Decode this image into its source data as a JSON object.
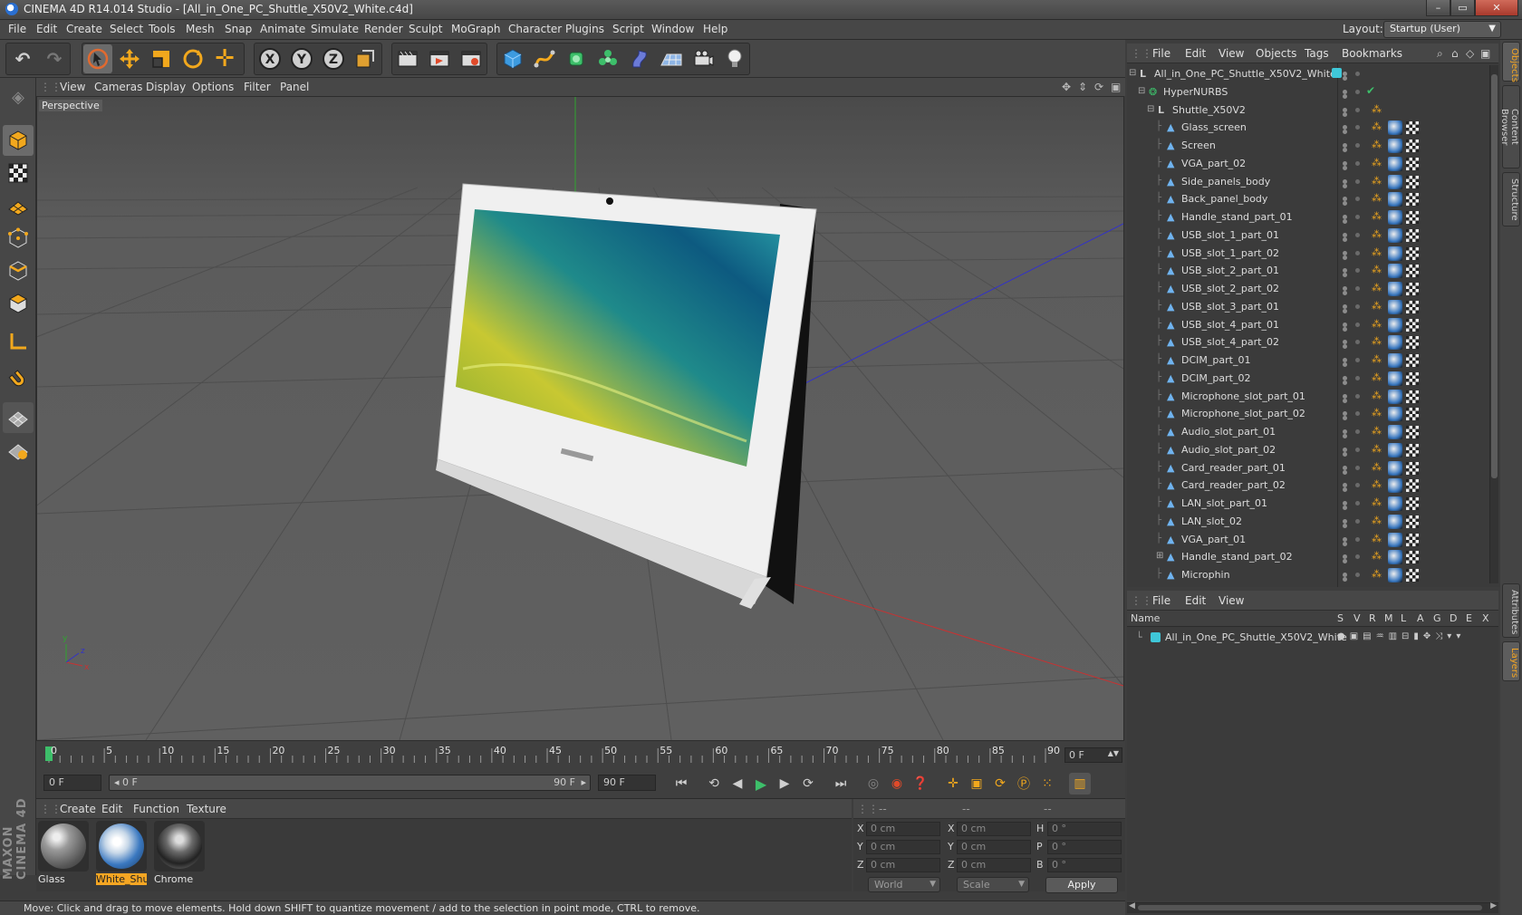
{
  "window": {
    "title": "CINEMA 4D R14.014 Studio - [All_in_One_PC_Shuttle_X50V2_White.c4d]",
    "controls": {
      "minimize": "–",
      "restore": "▭",
      "close": "✕"
    }
  },
  "menubar": {
    "items": [
      "File",
      "Edit",
      "Create",
      "Select",
      "Tools",
      "Mesh",
      "Snap",
      "Animate",
      "Simulate",
      "Render",
      "Sculpt",
      "MoGraph",
      "Character",
      "Plugins",
      "Script",
      "Window",
      "Help"
    ],
    "layout_label": "Layout:",
    "layout_value": "Startup (User)"
  },
  "viewport": {
    "menu": [
      "View",
      "Cameras",
      "Display",
      "Options",
      "Filter",
      "Panel"
    ],
    "label": "Perspective"
  },
  "timeline": {
    "ticks": [
      "0",
      "5",
      "10",
      "15",
      "20",
      "25",
      "30",
      "35",
      "40",
      "45",
      "50",
      "55",
      "60",
      "65",
      "70",
      "75",
      "80",
      "85",
      "90"
    ],
    "current_frame_field": "0 F"
  },
  "transport": {
    "start_field": "0 F",
    "range_start": "0 F",
    "range_end": "90 F",
    "end_field": "90 F"
  },
  "materials": {
    "menu": [
      "Create",
      "Edit",
      "Function",
      "Texture"
    ],
    "items": [
      {
        "name": "Glass",
        "selected": false
      },
      {
        "name": "White_Shu",
        "selected": true
      },
      {
        "name": "Chrome",
        "selected": false
      }
    ]
  },
  "coordinates": {
    "headers": [
      "--",
      "--",
      "--"
    ],
    "rows": [
      {
        "a": "X",
        "av": "0 cm",
        "b": "X",
        "bv": "0 cm",
        "c": "H",
        "cv": "0 °"
      },
      {
        "a": "Y",
        "av": "0 cm",
        "b": "Y",
        "bv": "0 cm",
        "c": "P",
        "cv": "0 °"
      },
      {
        "a": "Z",
        "av": "0 cm",
        "b": "Z",
        "bv": "0 cm",
        "c": "B",
        "cv": "0 °"
      }
    ],
    "mode_select": "World",
    "scale_select": "Scale",
    "apply_label": "Apply"
  },
  "status": "Move: Click and drag to move elements. Hold down SHIFT to quantize movement / add to the selection in point mode, CTRL to remove.",
  "object_manager": {
    "menu": [
      "File",
      "Edit",
      "View",
      "Objects",
      "Tags",
      "Bookmarks"
    ],
    "objects": [
      {
        "name": "All_in_One_PC_Shuttle_X50V2_White",
        "level": 0,
        "type": "null"
      },
      {
        "name": "HyperNURBS",
        "level": 1,
        "type": "nurbs"
      },
      {
        "name": "Shuttle_X50V2",
        "level": 2,
        "type": "null"
      },
      {
        "name": "Glass_screen",
        "level": 3,
        "type": "poly"
      },
      {
        "name": "Screen",
        "level": 3,
        "type": "poly"
      },
      {
        "name": "VGA_part_02",
        "level": 3,
        "type": "poly"
      },
      {
        "name": "Side_panels_body",
        "level": 3,
        "type": "poly"
      },
      {
        "name": "Back_panel_body",
        "level": 3,
        "type": "poly"
      },
      {
        "name": "Handle_stand_part_01",
        "level": 3,
        "type": "poly"
      },
      {
        "name": "USB_slot_1_part_01",
        "level": 3,
        "type": "poly"
      },
      {
        "name": "USB_slot_1_part_02",
        "level": 3,
        "type": "poly"
      },
      {
        "name": "USB_slot_2_part_01",
        "level": 3,
        "type": "poly"
      },
      {
        "name": "USB_slot_2_part_02",
        "level": 3,
        "type": "poly"
      },
      {
        "name": "USB_slot_3_part_01",
        "level": 3,
        "type": "poly"
      },
      {
        "name": "USB_slot_4_part_01",
        "level": 3,
        "type": "poly"
      },
      {
        "name": "USB_slot_4_part_02",
        "level": 3,
        "type": "poly"
      },
      {
        "name": "DCIM_part_01",
        "level": 3,
        "type": "poly"
      },
      {
        "name": "DCIM_part_02",
        "level": 3,
        "type": "poly"
      },
      {
        "name": "Microphone_slot_part_01",
        "level": 3,
        "type": "poly"
      },
      {
        "name": "Microphone_slot_part_02",
        "level": 3,
        "type": "poly"
      },
      {
        "name": "Audio_slot_part_01",
        "level": 3,
        "type": "poly"
      },
      {
        "name": "Audio_slot_part_02",
        "level": 3,
        "type": "poly"
      },
      {
        "name": "Card_reader_part_01",
        "level": 3,
        "type": "poly"
      },
      {
        "name": "Card_reader_part_02",
        "level": 3,
        "type": "poly"
      },
      {
        "name": "LAN_slot_part_01",
        "level": 3,
        "type": "poly"
      },
      {
        "name": "LAN_slot_02",
        "level": 3,
        "type": "poly"
      },
      {
        "name": "VGA_part_01",
        "level": 3,
        "type": "poly"
      },
      {
        "name": "Handle_stand_part_02",
        "level": 3,
        "type": "poly"
      },
      {
        "name": "Microphin",
        "level": 3,
        "type": "poly"
      }
    ]
  },
  "layer_manager": {
    "menu": [
      "File",
      "Edit",
      "View"
    ],
    "columns": [
      "Name",
      "S",
      "V",
      "R",
      "M",
      "L",
      "A",
      "G",
      "D",
      "E",
      "X"
    ],
    "layers": [
      {
        "name": "All_in_One_PC_Shuttle_X50V2_White",
        "color": "#3fc7d8"
      }
    ]
  },
  "side_tabs": [
    "Objects",
    "Content Browser",
    "Structure",
    "Attributes",
    "Layers"
  ],
  "brand": "MAXON CINEMA 4D",
  "colors": {
    "accent": "#f5a623",
    "axis_x": "#c83232",
    "axis_y": "#2fa52f",
    "axis_z": "#3232c8",
    "layer": "#3fc7d8"
  }
}
